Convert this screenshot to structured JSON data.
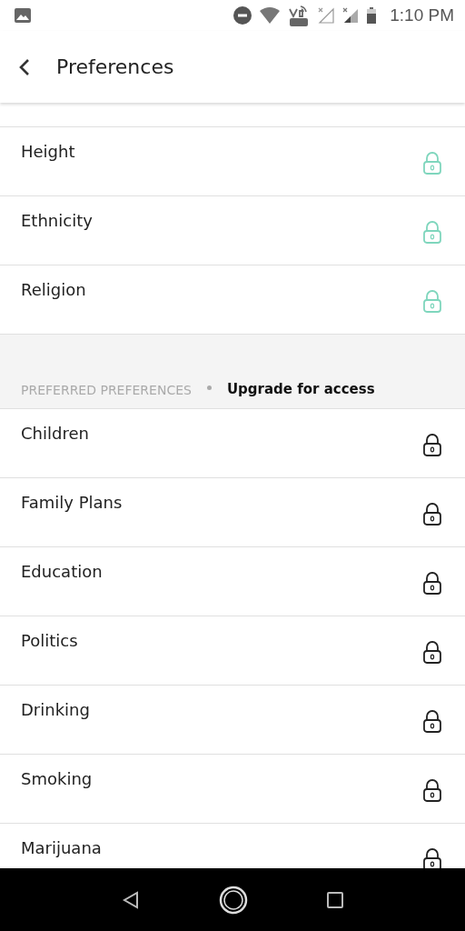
{
  "status_bar": {
    "time": "1:10 PM"
  },
  "app_bar": {
    "title": "Preferences"
  },
  "sections": [
    {
      "items": [
        {
          "label": "Height",
          "color": "#7fd6bd"
        },
        {
          "label": "Ethnicity",
          "color": "#7fd6bd"
        },
        {
          "label": "Religion",
          "color": "#7fd6bd"
        }
      ]
    },
    {
      "header": "PREFERRED PREFERENCES",
      "action": "Upgrade for access",
      "items": [
        {
          "label": "Children",
          "color": "#222222"
        },
        {
          "label": "Family Plans",
          "color": "#222222"
        },
        {
          "label": "Education",
          "color": "#222222"
        },
        {
          "label": "Politics",
          "color": "#222222"
        },
        {
          "label": "Drinking",
          "color": "#222222"
        },
        {
          "label": "Smoking",
          "color": "#222222"
        },
        {
          "label": "Marijuana",
          "color": "#222222"
        }
      ]
    }
  ]
}
